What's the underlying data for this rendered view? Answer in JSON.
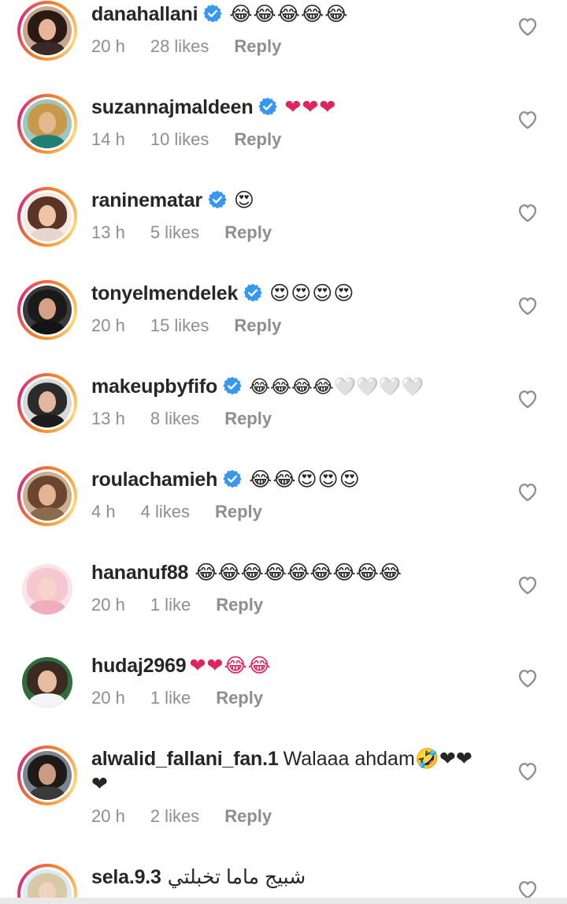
{
  "comments": [
    {
      "username": "danahallani",
      "verified": true,
      "text": "😂😂😂😂😂",
      "time": "20 h",
      "likes": "28 likes",
      "reply": "Reply",
      "avatar": {
        "hair": "#2a1a14",
        "face": "#e8b59a",
        "body": "#3a2a26",
        "bg": "#c9a58e"
      },
      "ring": true
    },
    {
      "username": "suzannajmaldeen",
      "verified": true,
      "text": "❤❤❤",
      "time": "14 h",
      "likes": "10 likes",
      "reply": "Reply",
      "avatar": {
        "hair": "#c69a4a",
        "face": "#e7b88f",
        "body": "#1f7f74",
        "bg": "#9ec7bd"
      },
      "ring": true
    },
    {
      "username": "raninematar",
      "verified": true,
      "text": "😍",
      "time": "13 h",
      "likes": "5 likes",
      "reply": "Reply",
      "avatar": {
        "hair": "#5a3526",
        "face": "#efc3a8",
        "body": "#e8d6cc",
        "bg": "#f4e9e3"
      },
      "ring": true
    },
    {
      "username": "tonyelmendelek",
      "verified": true,
      "text": "😍😍😍😍",
      "time": "20 h",
      "likes": "15 likes",
      "reply": "Reply",
      "avatar": {
        "hair": "#1a1a1a",
        "face": "#d6a184",
        "body": "#141414",
        "bg": "#3a3a3a"
      },
      "ring": true
    },
    {
      "username": "makeupbyfifo",
      "verified": true,
      "text": "😂😂😂😂🤍🤍🤍🤍",
      "time": "13 h",
      "likes": "8 likes",
      "reply": "Reply",
      "avatar": {
        "hair": "#2b2b2b",
        "face": "#e2b79d",
        "body": "#1c1c1c",
        "bg": "#d9d9d9"
      },
      "ring": true
    },
    {
      "username": "roulachamieh",
      "verified": true,
      "text": "😂😂😍😍😍",
      "time": "4 h",
      "likes": "4 likes",
      "reply": "Reply",
      "avatar": {
        "hair": "#6a4530",
        "face": "#e4b493",
        "body": "#8c6a4d",
        "bg": "#c9b08f"
      },
      "ring": true
    },
    {
      "username": "hananuf88",
      "verified": false,
      "text": "😂😂😂😂😂😂😂😂😂",
      "time": "20 h",
      "likes": "1 like",
      "reply": "Reply",
      "avatar": {
        "hair": "#f4c7d1",
        "face": "#f6d4cc",
        "body": "#f0aebd",
        "bg": "#fbe3ea"
      },
      "ring": false
    },
    {
      "username": "hudaj2969",
      "verified": false,
      "text": "❤❤😂😂",
      "time": "20 h",
      "likes": "1 like",
      "reply": "Reply",
      "avatar": {
        "hair": "#3a2a22",
        "face": "#e8bd9f",
        "body": "#f4f4f4",
        "bg": "#2f6e3a"
      },
      "ring": false
    },
    {
      "username": "alwalid_fallani_fan.1",
      "verified": false,
      "text": "Walaaa ahdam🤣❤❤❤",
      "time": "20 h",
      "likes": "2 likes",
      "reply": "Reply",
      "avatar": {
        "hair": "#1e1a18",
        "face": "#c99c80",
        "body": "#3a3a3a",
        "bg": "#7b8590"
      },
      "ring": true
    },
    {
      "username": "sela.9.3",
      "verified": false,
      "text": "شبيج ماما تخبلتي",
      "time": "",
      "likes": "",
      "reply": "",
      "avatar": {
        "hair": "#d8c9a6",
        "face": "#f1d2bf",
        "body": "#b9d4e6",
        "bg": "#d9ecf6"
      },
      "ring": true
    }
  ],
  "icons": {
    "verified_color": "#3897f0",
    "like": "heart-outline-icon"
  }
}
